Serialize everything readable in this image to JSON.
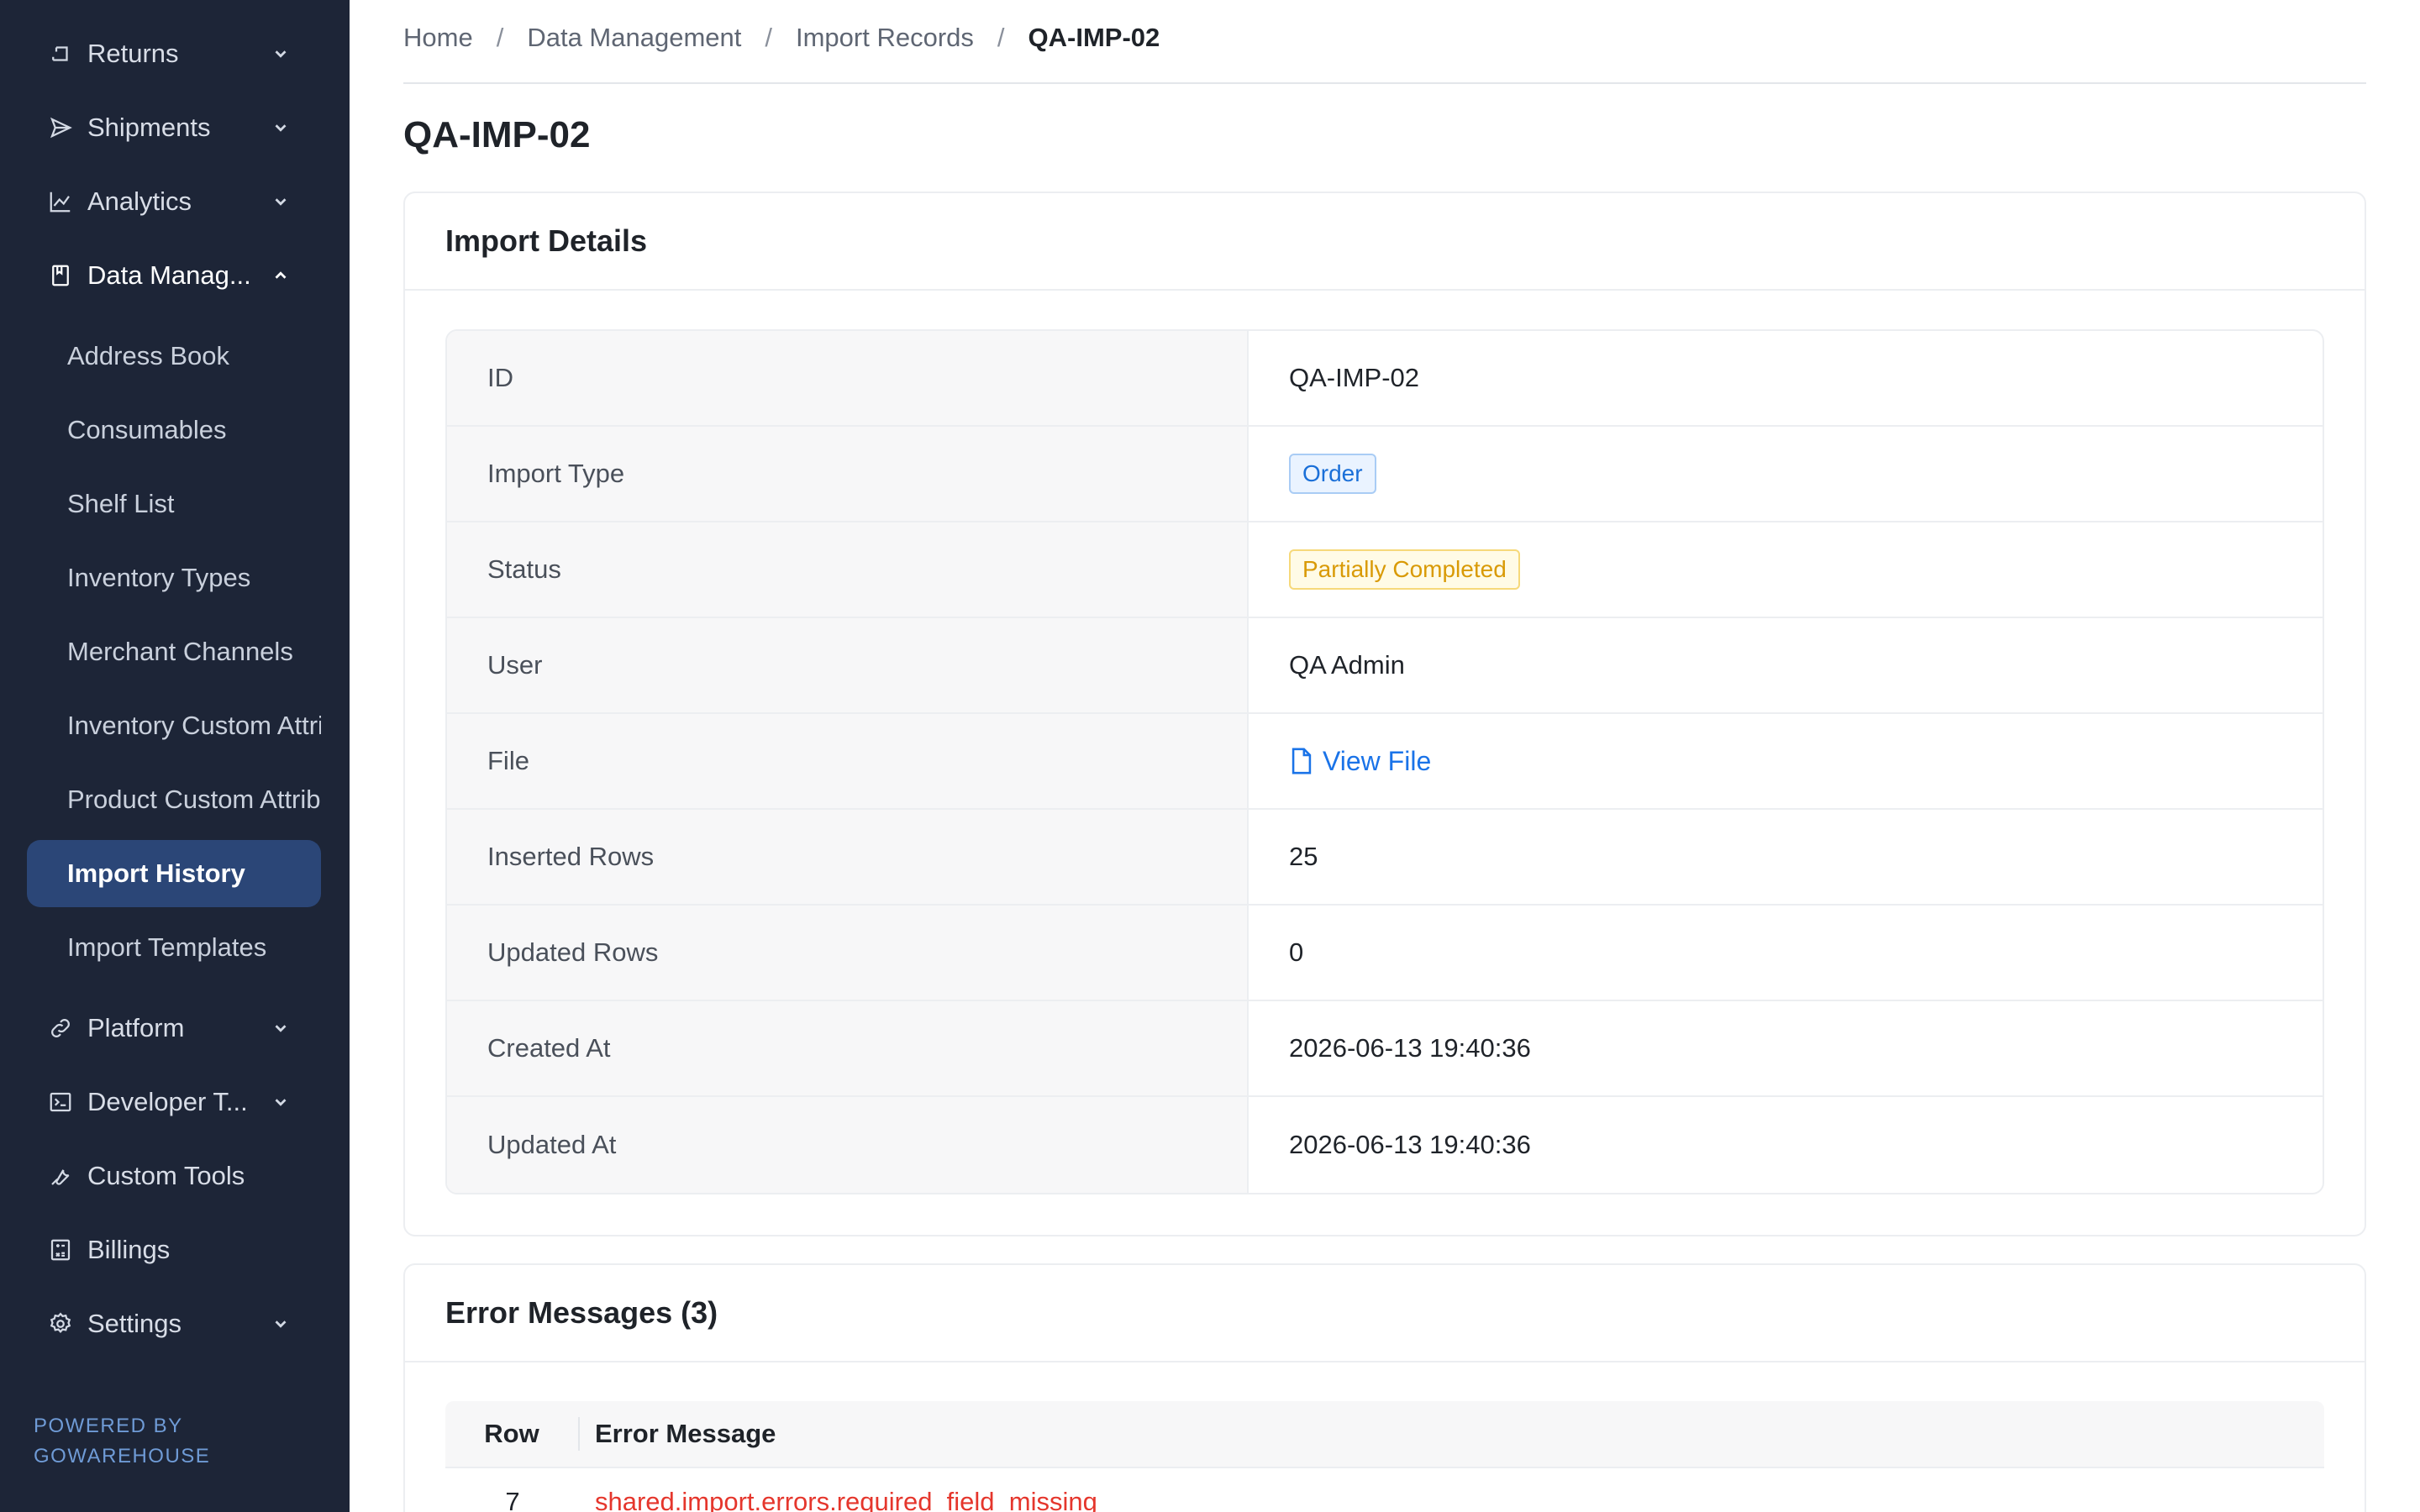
{
  "sidebar": {
    "groups": [
      {
        "label": "Returns",
        "icon": "return-icon",
        "expanded": false
      },
      {
        "label": "Shipments",
        "icon": "send-icon",
        "expanded": false
      },
      {
        "label": "Analytics",
        "icon": "line-chart-icon",
        "expanded": false
      },
      {
        "label": "Data Manag...",
        "icon": "book-icon",
        "expanded": true
      },
      {
        "label": "Platform",
        "icon": "link-icon",
        "expanded": false
      },
      {
        "label": "Developer T...",
        "icon": "terminal-icon",
        "expanded": false
      },
      {
        "label": "Custom Tools",
        "icon": "wrench-icon",
        "expanded": false
      },
      {
        "label": "Billings",
        "icon": "calculator-icon",
        "expanded": false
      },
      {
        "label": "Settings",
        "icon": "gear-icon",
        "expanded": false
      }
    ],
    "sub_items": [
      {
        "label": "Address Book"
      },
      {
        "label": "Consumables"
      },
      {
        "label": "Shelf List"
      },
      {
        "label": "Inventory Types"
      },
      {
        "label": "Merchant Channels"
      },
      {
        "label": "Inventory Custom Attributes"
      },
      {
        "label": "Product Custom Attributes"
      },
      {
        "label": "Import History",
        "selected": true
      },
      {
        "label": "Import Templates"
      }
    ],
    "powered_line1": "POWERED BY",
    "powered_line2": "GOWAREHOUSE"
  },
  "breadcrumb": {
    "home": "Home",
    "section": "Data Management",
    "list": "Import Records",
    "current": "QA-IMP-02"
  },
  "page_title": "QA-IMP-02",
  "details": {
    "title": "Import Details",
    "rows": {
      "id": {
        "label": "ID",
        "value": "QA-IMP-02"
      },
      "import_type": {
        "label": "Import Type",
        "value": "Order"
      },
      "status": {
        "label": "Status",
        "value": "Partially Completed"
      },
      "user": {
        "label": "User",
        "value": "QA Admin"
      },
      "file": {
        "label": "File",
        "value": "View File"
      },
      "inserted_rows": {
        "label": "Inserted Rows",
        "value": "25"
      },
      "updated_rows": {
        "label": "Updated Rows",
        "value": "0"
      },
      "created_at": {
        "label": "Created At",
        "value": "2026-06-13 19:40:36"
      },
      "updated_at": {
        "label": "Updated At",
        "value": "2026-06-13 19:40:36"
      }
    }
  },
  "errors": {
    "title": "Error Messages (3)",
    "columns": {
      "row": "Row",
      "message": "Error Message"
    },
    "rows": [
      {
        "row": "7",
        "message": "shared.import.errors.required_field_missing"
      }
    ]
  },
  "colors": {
    "sidebar_bg": "#1d2537",
    "sidebar_selected": "#2b4677",
    "link": "#1a73e8",
    "order_tag": "#1a6fd8",
    "status_tag": "#d99a06",
    "error_text": "#e5362c"
  }
}
